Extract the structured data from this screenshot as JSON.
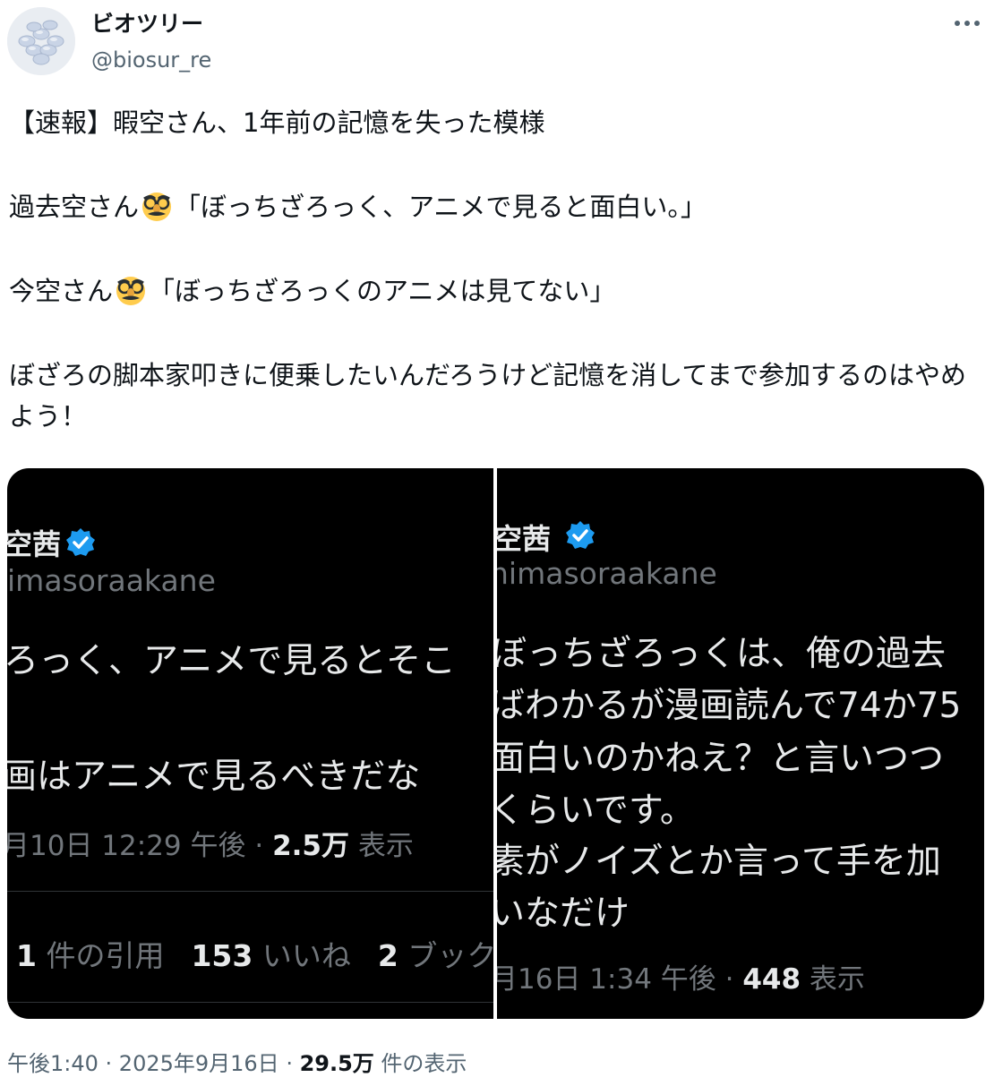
{
  "author": {
    "name": "ビオツリー",
    "handle": "@biosur_re",
    "avatar_icon": "pills-icon"
  },
  "more_icon": "more-horizontal-icon",
  "tweet": {
    "line1": "【速報】暇空さん、1年前の記憶を失った模様",
    "line2_prefix": "過去空さん",
    "line2_suffix": "「ぼっちざろっく、アニメで見ると面白い。」",
    "line3_prefix": "今空さん",
    "line3_suffix": "「ぼっちざろっくのアニメは見てない」",
    "line4": "ぼざろの脚本家叩きに便乗したいんだろうけど記憶を消してまで参加するのはやめよう！",
    "emoji_icon": "disguised-face-icon"
  },
  "screenshot_left": {
    "name": "空茜",
    "handle": "imasoraakane",
    "body_line1": "ろっく、アニメで見るとそこ",
    "body_line2": "画はアニメで見るべきだな",
    "date": "月10日 12:29 午後 · ",
    "views_count": "2.5万",
    "views_label": " 表示",
    "quotes_count": "1",
    "quotes_label": " 件の引用",
    "likes_count": "153",
    "likes_label": " いいね",
    "bookmarks_count": "2",
    "bookmarks_label": " ブック"
  },
  "screenshot_right": {
    "name": "空茜",
    "handle": "himasoraakane",
    "body_lines": [
      "ぼっちざろっくは、俺の過去",
      "ばわかるが漫画読んで74か75",
      "面白いのかねえ？と言いつつ",
      "くらいです。",
      "素がノイズとか言って手を加",
      "いなだけ"
    ],
    "date": "月16日 1:34 午後 · ",
    "views_count": "448",
    "views_label": " 表示"
  },
  "footer": {
    "time": "午後1:40",
    "separator": " · ",
    "date": "2025年9月16日",
    "views_count": "29.5万",
    "views_label": " 件の表示"
  }
}
